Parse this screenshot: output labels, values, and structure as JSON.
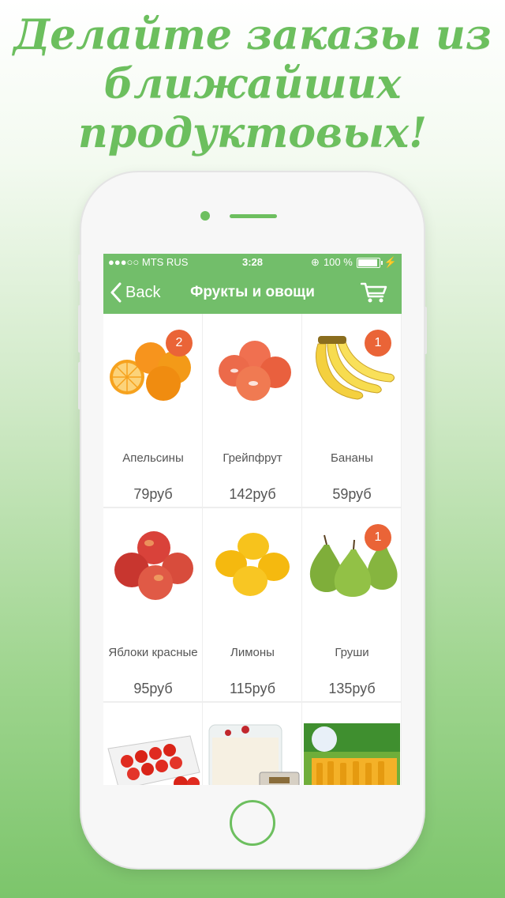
{
  "promo": {
    "lines": [
      "Делайте заказы из",
      "ближайших",
      "продуктовых!"
    ]
  },
  "statusbar": {
    "carrier": "●●●○○ MTS RUS",
    "time": "3:28",
    "battery_text": "100 %",
    "battery_level": 1.0
  },
  "navbar": {
    "back_label": "Back",
    "title": "Фрукты и овощи",
    "cart_icon": "cart-icon"
  },
  "products": [
    {
      "name": "Апельсины",
      "price": "79руб",
      "badge": "2",
      "icon": "oranges"
    },
    {
      "name": "Грейпфрут",
      "price": "142руб",
      "badge": "",
      "icon": "grapefruit"
    },
    {
      "name": "Бананы",
      "price": "59руб",
      "badge": "1",
      "icon": "bananas"
    },
    {
      "name": "Яблоки красные",
      "price": "95руб",
      "badge": "",
      "icon": "apples"
    },
    {
      "name": "Лимоны",
      "price": "115руб",
      "badge": "",
      "icon": "lemons"
    },
    {
      "name": "Груши",
      "price": "135руб",
      "badge": "1",
      "icon": "pears"
    },
    {
      "name": "",
      "price": "",
      "badge": "",
      "icon": "tomatoes"
    },
    {
      "name": "",
      "price": "",
      "badge": "",
      "icon": "salad-container"
    },
    {
      "name": "",
      "price": "",
      "badge": "",
      "icon": "frozen-potatoes"
    }
  ],
  "colors": {
    "accent_green": "#72be6a",
    "badge_orange": "#ea6437"
  }
}
